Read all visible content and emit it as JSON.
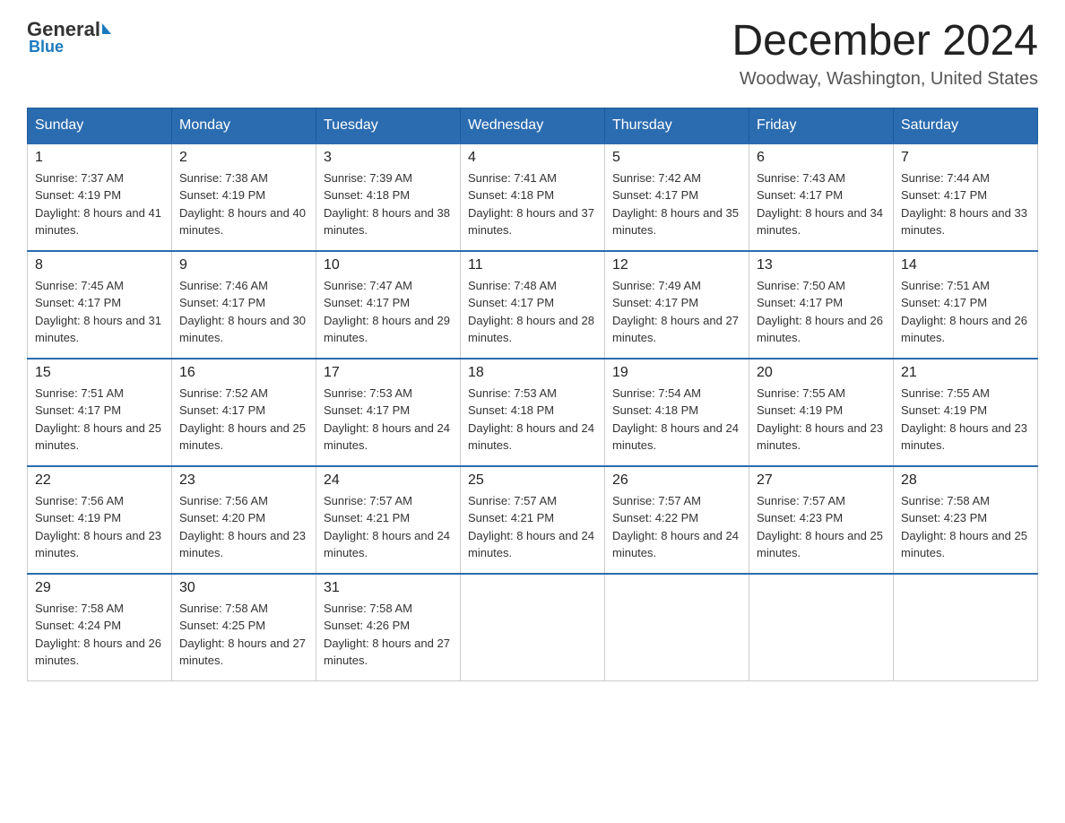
{
  "logo": {
    "general": "General",
    "arrow": "",
    "blue": "Blue"
  },
  "header": {
    "month_year": "December 2024",
    "location": "Woodway, Washington, United States"
  },
  "days_of_week": [
    "Sunday",
    "Monday",
    "Tuesday",
    "Wednesday",
    "Thursday",
    "Friday",
    "Saturday"
  ],
  "weeks": [
    [
      {
        "day": "1",
        "sunrise": "7:37 AM",
        "sunset": "4:19 PM",
        "daylight": "8 hours and 41 minutes."
      },
      {
        "day": "2",
        "sunrise": "7:38 AM",
        "sunset": "4:19 PM",
        "daylight": "8 hours and 40 minutes."
      },
      {
        "day": "3",
        "sunrise": "7:39 AM",
        "sunset": "4:18 PM",
        "daylight": "8 hours and 38 minutes."
      },
      {
        "day": "4",
        "sunrise": "7:41 AM",
        "sunset": "4:18 PM",
        "daylight": "8 hours and 37 minutes."
      },
      {
        "day": "5",
        "sunrise": "7:42 AM",
        "sunset": "4:17 PM",
        "daylight": "8 hours and 35 minutes."
      },
      {
        "day": "6",
        "sunrise": "7:43 AM",
        "sunset": "4:17 PM",
        "daylight": "8 hours and 34 minutes."
      },
      {
        "day": "7",
        "sunrise": "7:44 AM",
        "sunset": "4:17 PM",
        "daylight": "8 hours and 33 minutes."
      }
    ],
    [
      {
        "day": "8",
        "sunrise": "7:45 AM",
        "sunset": "4:17 PM",
        "daylight": "8 hours and 31 minutes."
      },
      {
        "day": "9",
        "sunrise": "7:46 AM",
        "sunset": "4:17 PM",
        "daylight": "8 hours and 30 minutes."
      },
      {
        "day": "10",
        "sunrise": "7:47 AM",
        "sunset": "4:17 PM",
        "daylight": "8 hours and 29 minutes."
      },
      {
        "day": "11",
        "sunrise": "7:48 AM",
        "sunset": "4:17 PM",
        "daylight": "8 hours and 28 minutes."
      },
      {
        "day": "12",
        "sunrise": "7:49 AM",
        "sunset": "4:17 PM",
        "daylight": "8 hours and 27 minutes."
      },
      {
        "day": "13",
        "sunrise": "7:50 AM",
        "sunset": "4:17 PM",
        "daylight": "8 hours and 26 minutes."
      },
      {
        "day": "14",
        "sunrise": "7:51 AM",
        "sunset": "4:17 PM",
        "daylight": "8 hours and 26 minutes."
      }
    ],
    [
      {
        "day": "15",
        "sunrise": "7:51 AM",
        "sunset": "4:17 PM",
        "daylight": "8 hours and 25 minutes."
      },
      {
        "day": "16",
        "sunrise": "7:52 AM",
        "sunset": "4:17 PM",
        "daylight": "8 hours and 25 minutes."
      },
      {
        "day": "17",
        "sunrise": "7:53 AM",
        "sunset": "4:17 PM",
        "daylight": "8 hours and 24 minutes."
      },
      {
        "day": "18",
        "sunrise": "7:53 AM",
        "sunset": "4:18 PM",
        "daylight": "8 hours and 24 minutes."
      },
      {
        "day": "19",
        "sunrise": "7:54 AM",
        "sunset": "4:18 PM",
        "daylight": "8 hours and 24 minutes."
      },
      {
        "day": "20",
        "sunrise": "7:55 AM",
        "sunset": "4:19 PM",
        "daylight": "8 hours and 23 minutes."
      },
      {
        "day": "21",
        "sunrise": "7:55 AM",
        "sunset": "4:19 PM",
        "daylight": "8 hours and 23 minutes."
      }
    ],
    [
      {
        "day": "22",
        "sunrise": "7:56 AM",
        "sunset": "4:19 PM",
        "daylight": "8 hours and 23 minutes."
      },
      {
        "day": "23",
        "sunrise": "7:56 AM",
        "sunset": "4:20 PM",
        "daylight": "8 hours and 23 minutes."
      },
      {
        "day": "24",
        "sunrise": "7:57 AM",
        "sunset": "4:21 PM",
        "daylight": "8 hours and 24 minutes."
      },
      {
        "day": "25",
        "sunrise": "7:57 AM",
        "sunset": "4:21 PM",
        "daylight": "8 hours and 24 minutes."
      },
      {
        "day": "26",
        "sunrise": "7:57 AM",
        "sunset": "4:22 PM",
        "daylight": "8 hours and 24 minutes."
      },
      {
        "day": "27",
        "sunrise": "7:57 AM",
        "sunset": "4:23 PM",
        "daylight": "8 hours and 25 minutes."
      },
      {
        "day": "28",
        "sunrise": "7:58 AM",
        "sunset": "4:23 PM",
        "daylight": "8 hours and 25 minutes."
      }
    ],
    [
      {
        "day": "29",
        "sunrise": "7:58 AM",
        "sunset": "4:24 PM",
        "daylight": "8 hours and 26 minutes."
      },
      {
        "day": "30",
        "sunrise": "7:58 AM",
        "sunset": "4:25 PM",
        "daylight": "8 hours and 27 minutes."
      },
      {
        "day": "31",
        "sunrise": "7:58 AM",
        "sunset": "4:26 PM",
        "daylight": "8 hours and 27 minutes."
      },
      null,
      null,
      null,
      null
    ]
  ]
}
